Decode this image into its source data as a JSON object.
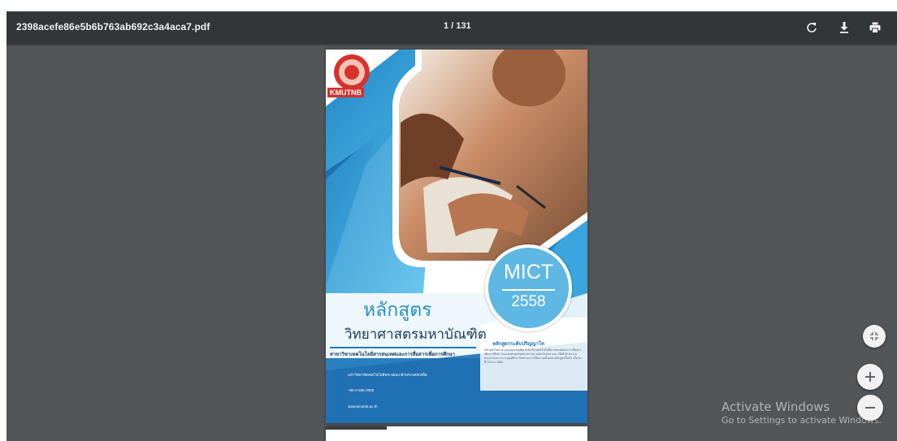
{
  "toolbar": {
    "file_name": "2398acefe86e5b6b763ab692c3a4aca7.pdf",
    "page_indicator": "1 / 131",
    "icons": [
      "rotate-icon",
      "download-icon",
      "print-icon"
    ]
  },
  "page": {
    "logo_text": "KMUTNB",
    "badge_title": "MICT",
    "badge_year": "2558",
    "title_thai": "หลักสูตร",
    "subtitle_thai": "วิทยาศาสตรมหาบัณฑิต",
    "department": "สาขาวิชาเทคโนโลยีสารสนเทศและการสื่อสารเพื่อการศึกษา",
    "right_heading": "หลักสูตรระดับปริญญาโท",
    "right_description": "หลักสูตรวิทยาศาสตรมหาบัณฑิต สาขาวิชาเทคโนโลยีสารสนเทศและการสื่อสารเพื่อการศึกษา คณะครุศาสตร์อุตสาหกรรม ฉบับปรับปรุง พ.ศ. 2558 สำนักงานคณะกรรมการการอุดมศึกษารับทราบการให้ความเห็นชอบหลักสูตรนี้แล้ว เมื่อวันที่ 10 ส.ค. 2561",
    "contacts": [
      {
        "icon": "location-icon",
        "text": "มหาวิทยาลัยเทคโนโลยีพระจอมเกล้าพระนครเหนือ"
      },
      {
        "icon": "phone-icon",
        "text": "+66-2-555-2000"
      },
      {
        "icon": "globe-icon",
        "text": "www.kmutnb.ac.th"
      }
    ]
  },
  "controls": {
    "fit": "fit-to-page-icon",
    "zoom_in": "+",
    "zoom_out": "−"
  },
  "watermark": {
    "title": "Activate Windows",
    "subtitle": "Go to Settings to activate Windows."
  },
  "colors": {
    "toolbar": "#323639",
    "viewer_bg": "#525659",
    "brand_blue": "#2a8fc8",
    "badge_blue": "#5fb8e3",
    "logo_red": "#d6322d"
  }
}
